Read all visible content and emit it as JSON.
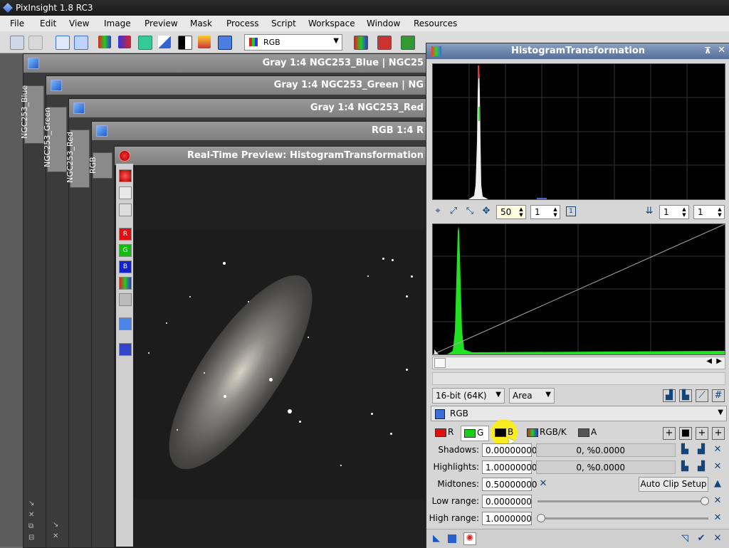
{
  "app": {
    "title": "PixInsight 1.8 RC3"
  },
  "menu": [
    "File",
    "Edit",
    "View",
    "Image",
    "Preview",
    "Mask",
    "Process",
    "Script",
    "Workspace",
    "Window",
    "Resources"
  ],
  "toolbar": {
    "channel_select": "RGB"
  },
  "windows": {
    "blue": {
      "title": "Gray 1:4 NGC253_Blue | NGC25",
      "tab": "NGC253_Blue"
    },
    "green": {
      "title": "Gray 1:4 NGC253_Green | NG",
      "tab": "NGC253_Green"
    },
    "red": {
      "title": "Gray 1:4 NGC253_Red",
      "tab": "NGC253_Red"
    },
    "rgb": {
      "title": "RGB 1:4 R",
      "tab": "RGB"
    },
    "preview": {
      "title": "Real-Time Preview: HistogramTransformation"
    }
  },
  "histogram_dialog": {
    "title": "HistogramTransformation",
    "zoom_h": "50",
    "zoom_v": "1",
    "zoom_h2": "1",
    "zoom_v2": "1",
    "resolution": "16-bit (64K)",
    "graph_style": "Area",
    "target": "RGB",
    "channels": [
      {
        "label": "R",
        "color": "#e01010"
      },
      {
        "label": "G",
        "color": "#18d018"
      },
      {
        "label": "B",
        "color": "#000000"
      },
      {
        "label": "RGB/K",
        "color": "#3355cc"
      },
      {
        "label": "A",
        "color": "#555555"
      }
    ],
    "shadows": {
      "label": "Shadows:",
      "value": "0.00000000",
      "readout": "0, %0.0000"
    },
    "highlights": {
      "label": "Highlights:",
      "value": "1.00000000",
      "readout": "0, %0.0000"
    },
    "midtones": {
      "label": "Midtones:",
      "value": "0.50000000"
    },
    "auto_clip": "Auto Clip Setup",
    "low_range": {
      "label": "Low range:",
      "value": "0.0000000"
    },
    "high_range": {
      "label": "High range:",
      "value": "1.0000000"
    }
  }
}
